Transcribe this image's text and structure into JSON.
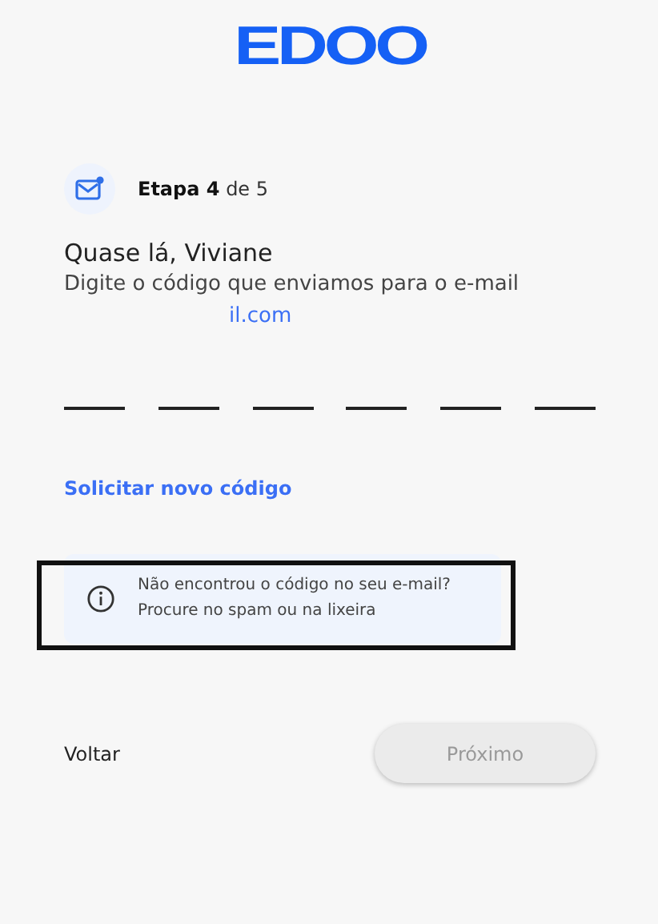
{
  "logo": {
    "text": "EDOO"
  },
  "step": {
    "label": "**Etapa 4** de 5"
  },
  "heading": "Quase lá, Viviane",
  "instructions": "Digite o código que enviamos para o e-mail",
  "email": "il.com",
  "code_fields": [
    {
      "kind": "digit"
    },
    {
      "kind": "digit"
    },
    {
      "kind": "digit"
    },
    {
      "kind": "digit"
    },
    {
      "kind": "digit"
    },
    {
      "kind": "digit"
    }
  ],
  "resend_link": "Solicitar novo código",
  "info": {
    "lines": [
      "Não encontrou o código no seu e-mail?",
      "Procure no spam ou na lixeira"
    ],
    "highlighted": true
  },
  "back_button": {
    "label": "Voltar"
  },
  "next_button": {
    "label": "Próximo",
    "disabled": true
  }
}
